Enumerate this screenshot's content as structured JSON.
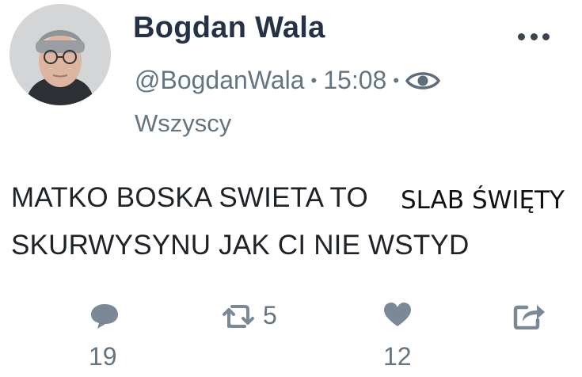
{
  "tweet": {
    "display_name": "Bogdan Wala",
    "handle": "@BogdanWala",
    "time": "15:08",
    "separator": "•",
    "audience": "Wszyscy",
    "text_line1": "MATKO BOSKA SWIETA TO",
    "text_line2": "SKURWYSYNU JAK CI NIE WSTYD",
    "overlay_text": "SLAB ŚWIĘTY"
  },
  "actions": {
    "reply_count": "19",
    "retweet_count": "5",
    "like_count": "12"
  },
  "icons": {
    "more": "more-dots-icon",
    "visibility": "eye-icon",
    "reply": "comment-bubble-icon",
    "retweet": "retweet-icon",
    "like": "heart-icon",
    "share": "share-icon"
  },
  "colors": {
    "name": "#253246",
    "meta": "#657481",
    "body": "#1f2328",
    "icon": "#7b8896"
  }
}
